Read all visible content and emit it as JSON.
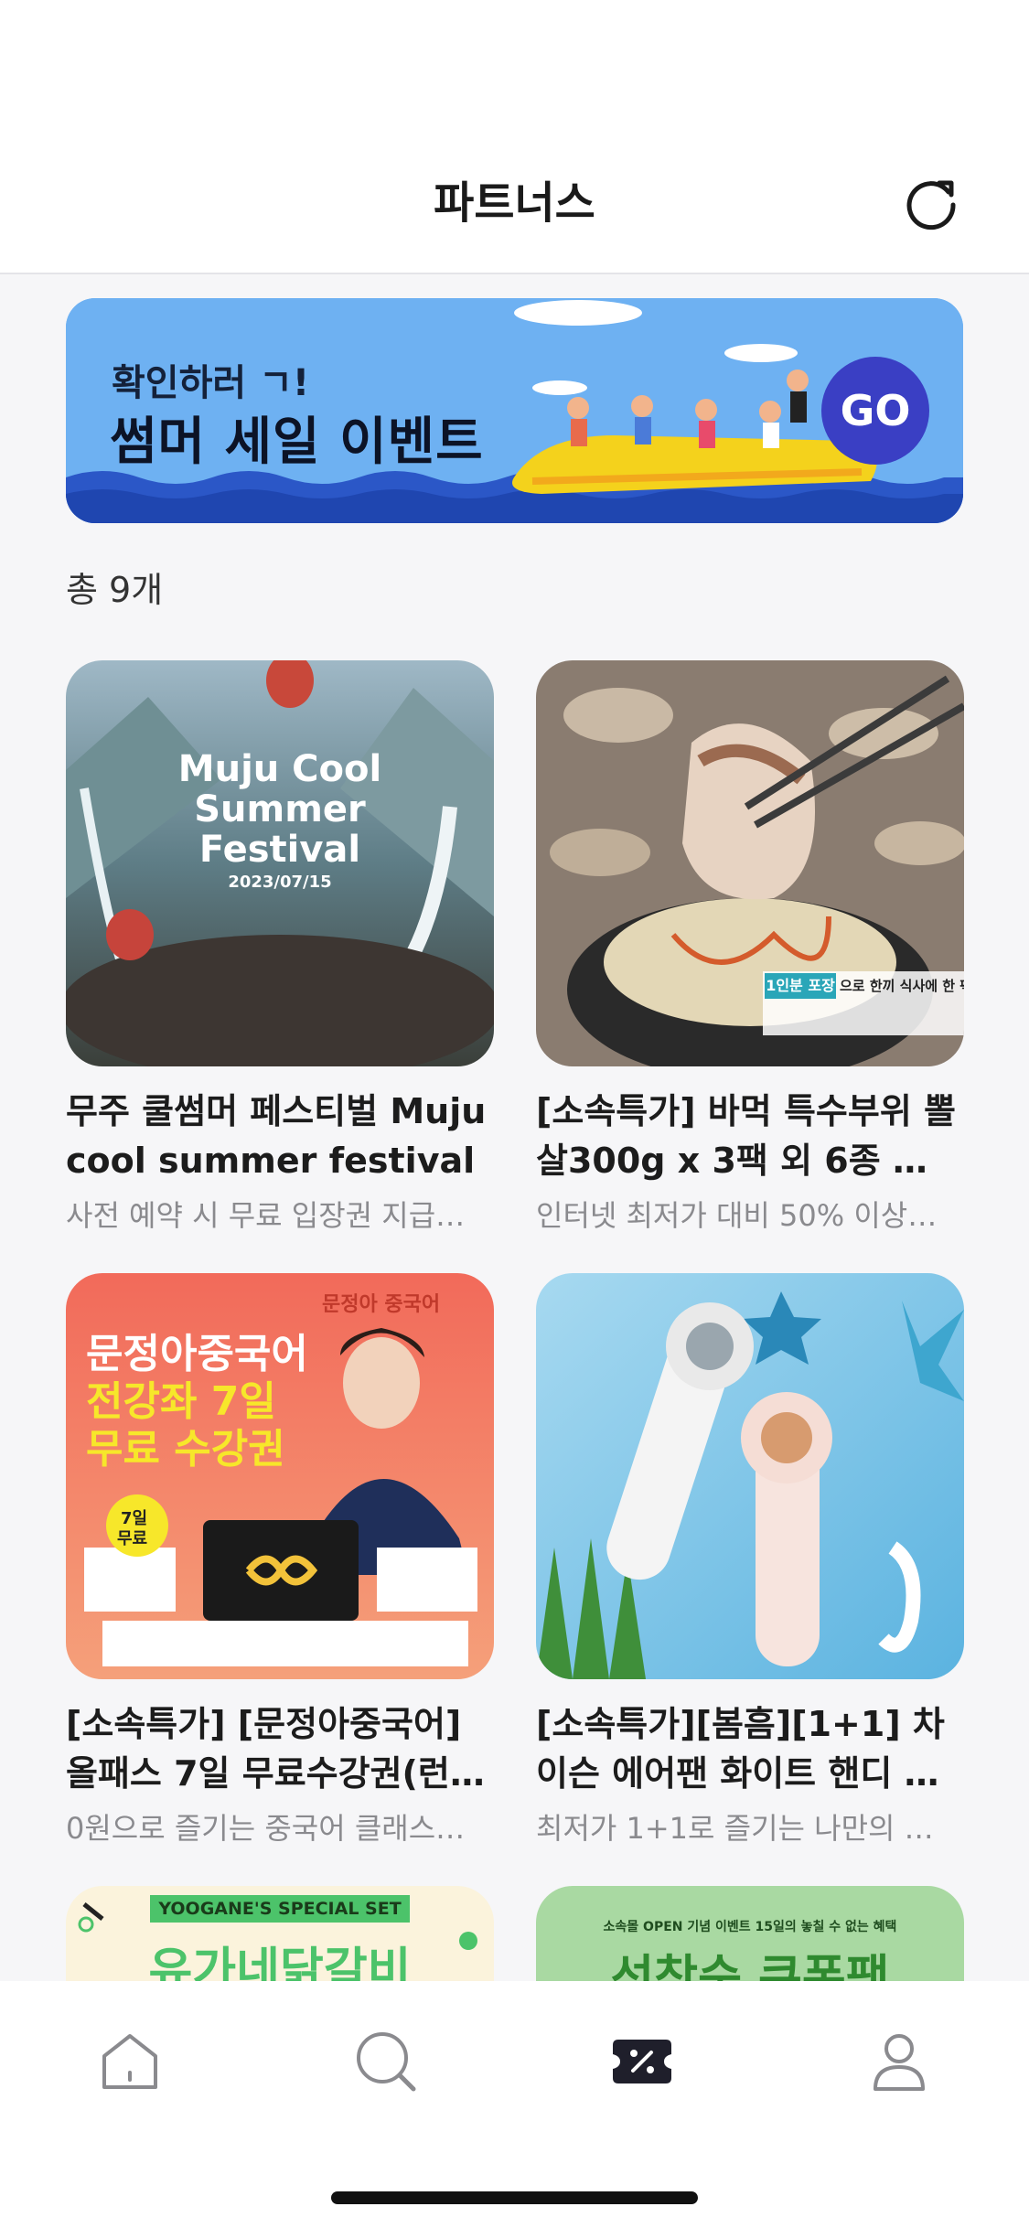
{
  "header": {
    "title": "파트너스"
  },
  "banner": {
    "subtitle": "확인하러 ㄱ!",
    "title": "썸머 세일 이벤트",
    "go_label": "GO"
  },
  "list": {
    "total_label": "총 9개",
    "items": [
      {
        "title": "무주 쿨썸머 페스티벌 Muju cool summer festival",
        "desc": "사전 예약 시 무료 입장권 지급…",
        "img_text": [
          "Muju Cool",
          "Summer",
          "Festival",
          "2023/07/15"
        ]
      },
      {
        "title": "[소속특가] 바먹 특수부위 뽈살300g x 3팩 외 6종 …",
        "desc": "인터넷 최저가 대비 50% 이상…",
        "img_text": [
          "1인분 포장",
          "으로 한끼 식사에 한 팩"
        ]
      },
      {
        "title": "[소속특가] [문정아중국어] 올패스 7일 무료수강권(런…",
        "desc": "0원으로 즐기는 중국어 클래스…",
        "img_text": [
          "문정아 중국어",
          "문정아중국어",
          "전강좌 7일",
          "무료 수강권",
          "7일",
          "무료"
        ]
      },
      {
        "title": "[소속특가][봄흠][1+1] 차이슨 에어팬 화이트 핸디 …",
        "desc": "최저가 1+1로 즐기는 나만의 …",
        "img_text": []
      },
      {
        "title": "",
        "desc": "",
        "img_text": [
          "YOOGANE'S SPECIAL SET",
          "유가네닭갈비"
        ]
      },
      {
        "title": "",
        "desc": "",
        "img_text": [
          "소속몰 OPEN 기념 이벤트 15일의 놓칠 수 없는 혜택",
          "선착순 쿠폰팩"
        ]
      }
    ]
  },
  "tabbar": {
    "items": [
      {
        "icon": "home-icon",
        "active": false
      },
      {
        "icon": "search-icon",
        "active": false
      },
      {
        "icon": "coupon-icon",
        "active": true
      },
      {
        "icon": "profile-icon",
        "active": false
      }
    ]
  },
  "colors": {
    "accent": "#1f1f2b",
    "banner_bg": "#6eb1f2",
    "go_button": "#3a3fc4",
    "muted_text": "#8a8a8e"
  }
}
